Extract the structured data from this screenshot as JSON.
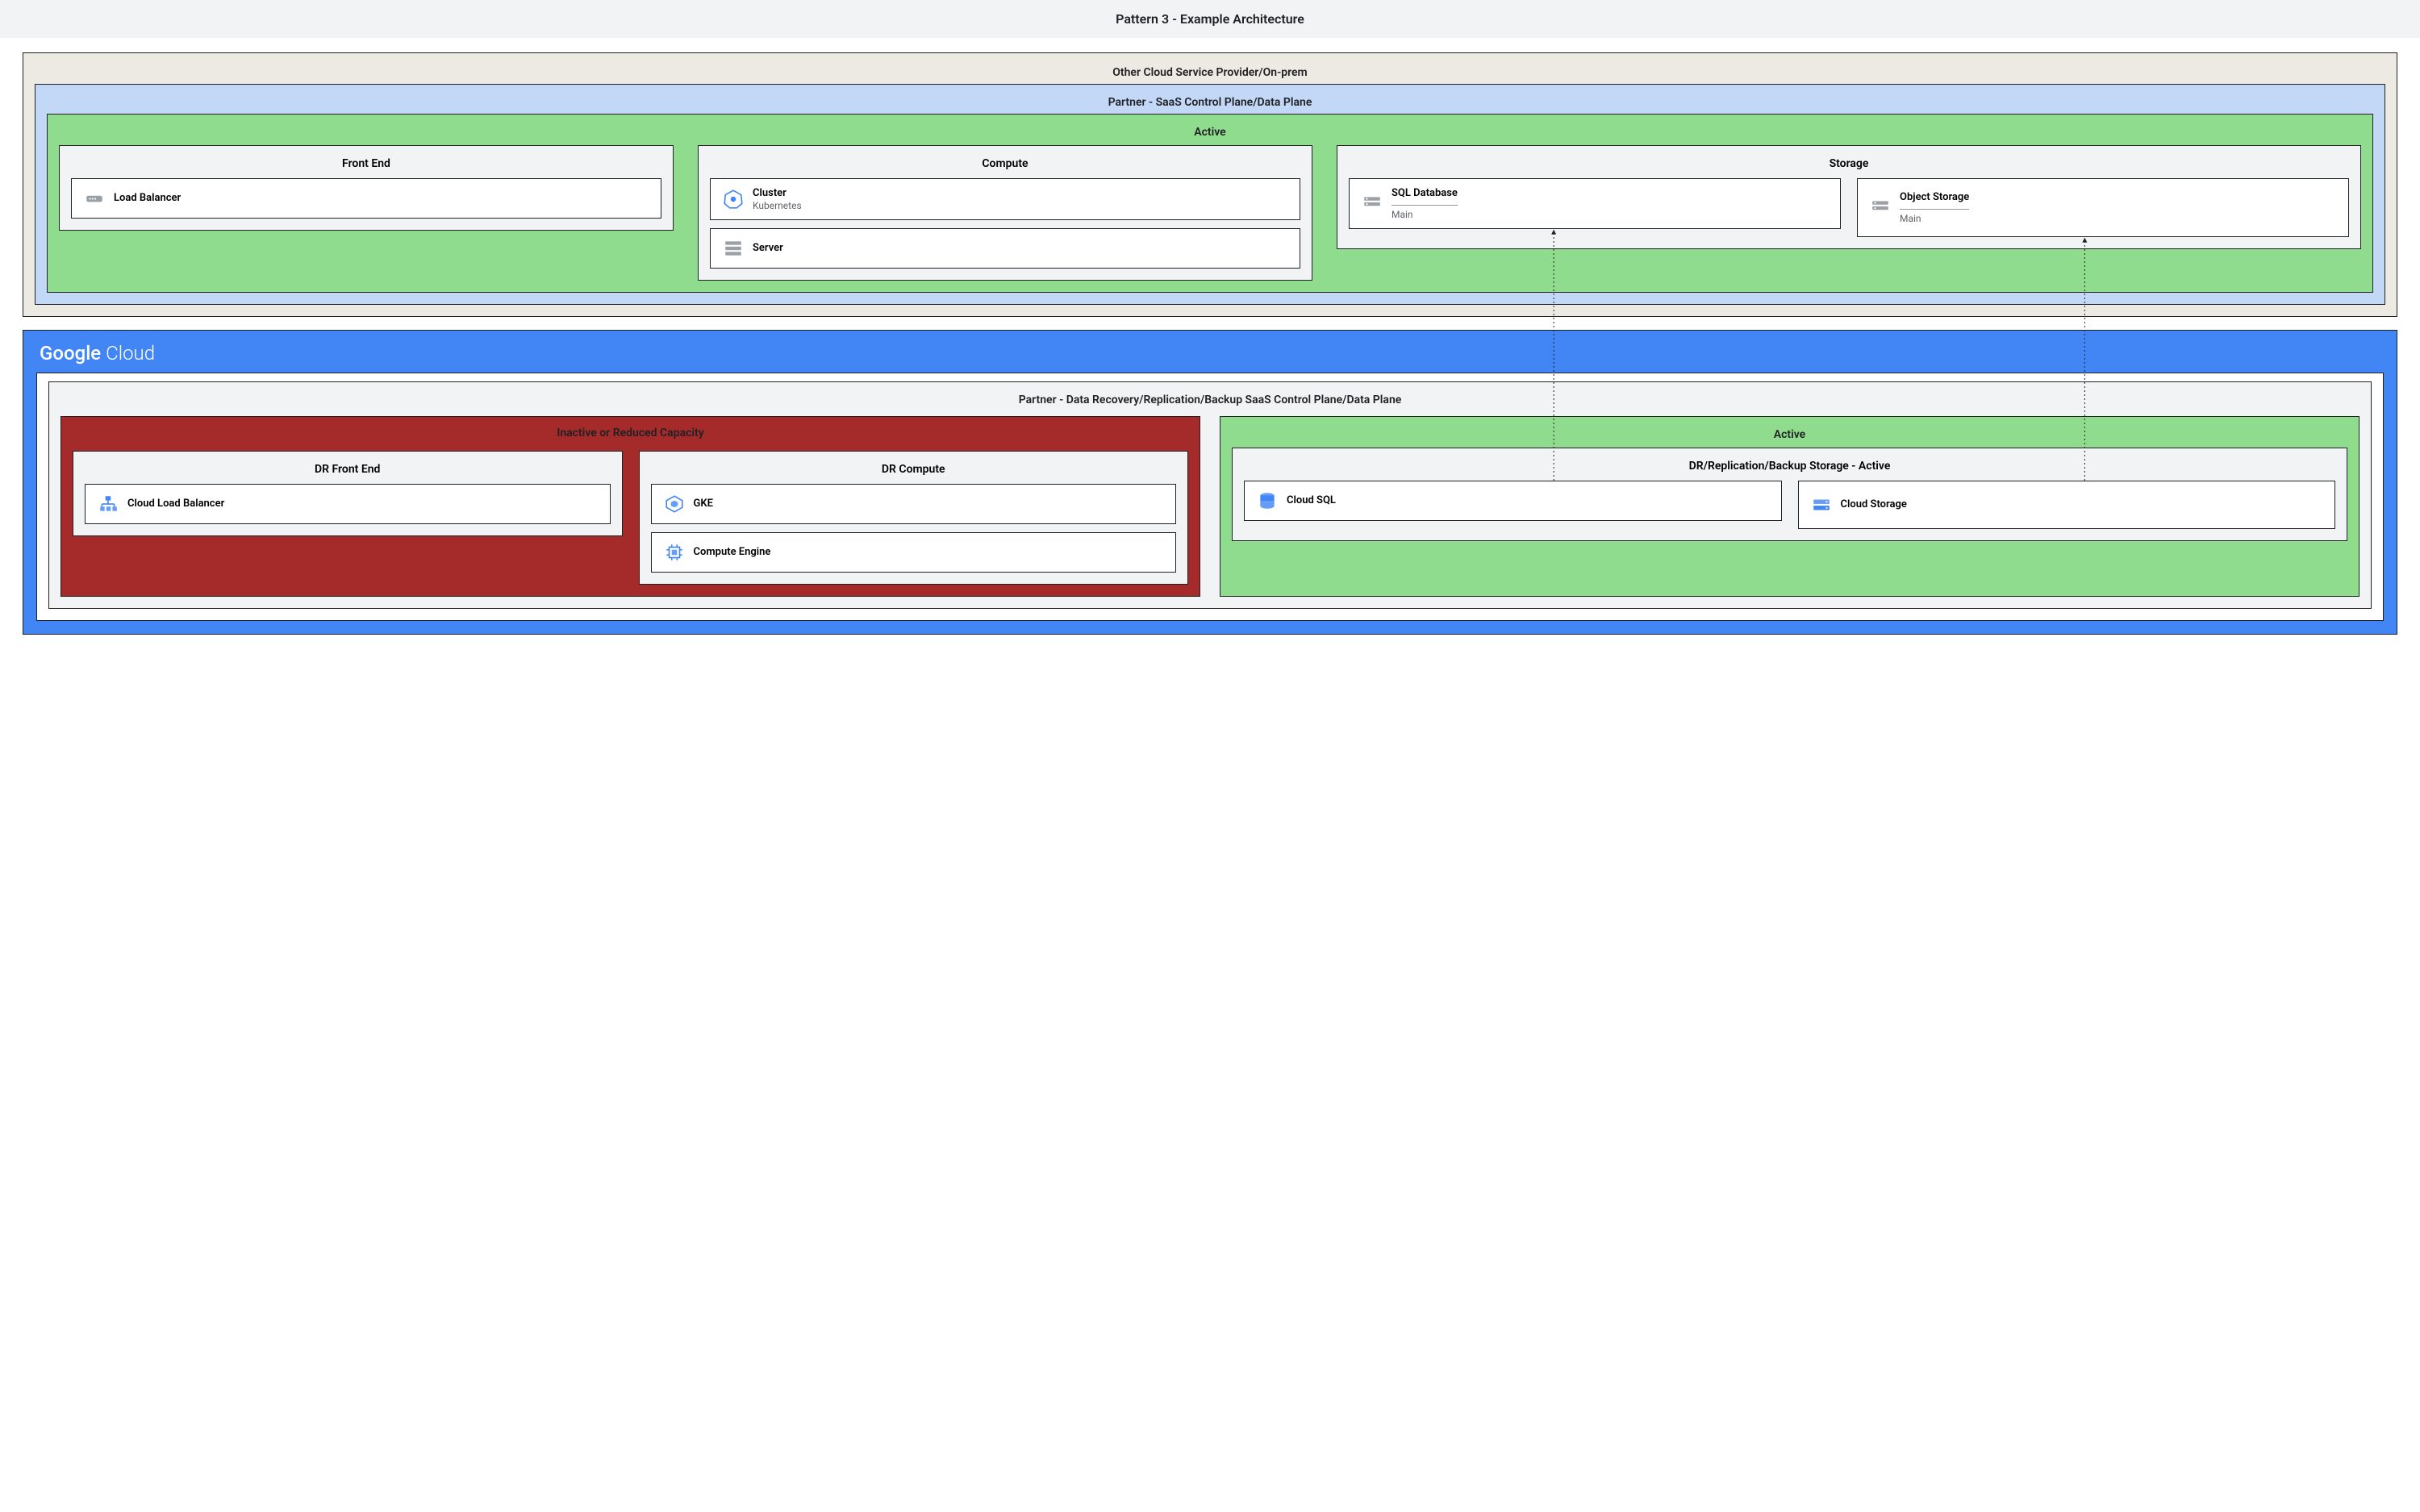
{
  "title": "Pattern 3 - Example Architecture",
  "top": {
    "outer": "Other Cloud Service Provider/On-prem",
    "partner": "Partner - SaaS Control Plane/Data Plane",
    "active": "Active",
    "frontend": {
      "title": "Front End",
      "lb": "Load Balancer"
    },
    "compute": {
      "title": "Compute",
      "k8s": "Cluster",
      "k8s_sub": "Kubernetes",
      "server": "Server"
    },
    "storage": {
      "title": "Storage",
      "sql": "SQL Database",
      "sql_sub": "Main",
      "obj": "Object Storage",
      "obj_sub": "Main"
    }
  },
  "gc": {
    "logo": "Google Cloud",
    "partner": "Partner - Data Recovery/Replication/Backup SaaS Control Plane/Data Plane",
    "inactive": "Inactive or Reduced Capacity",
    "dr_fe": {
      "title": "DR Front End",
      "lb": "Cloud Load Balancer"
    },
    "dr_compute": {
      "title": "DR Compute",
      "gke": "GKE",
      "ce": "Compute Engine"
    },
    "active": "Active",
    "dr_storage": {
      "title": "DR/Replication/Backup Storage - Active",
      "sql": "Cloud SQL",
      "cs": "Cloud Storage"
    }
  }
}
